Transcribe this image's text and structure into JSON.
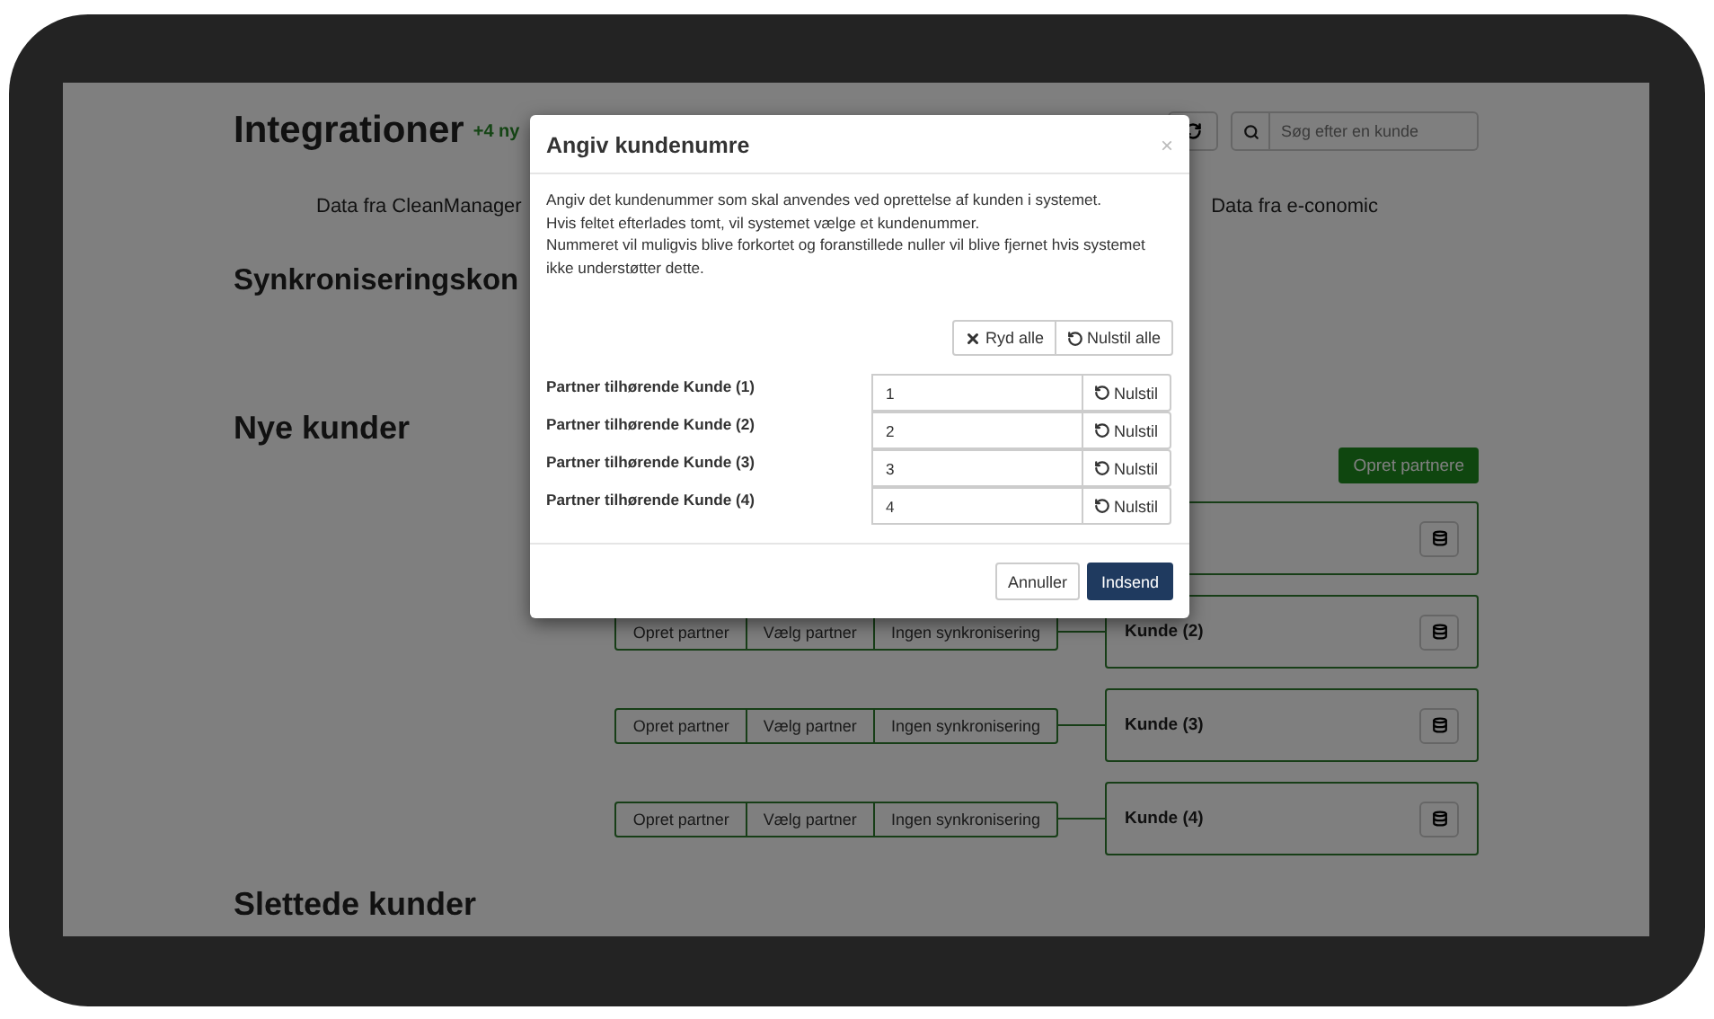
{
  "page": {
    "title": "Integrationer",
    "new_badge": "+4 ny",
    "refresh_button": true,
    "search": {
      "placeholder": "Søg efter en kunde"
    },
    "source_left": "Data fra CleanManager",
    "source_right": "Data fra e-conomic",
    "sync_heading": "Synkroniseringskon",
    "new_heading": "Nye kunder",
    "create_all_button": "Opret partnere",
    "customers": [
      {
        "kind": "card_only"
      },
      {
        "kind": "full",
        "actions": [
          "Opret partner",
          "Vælg partner",
          "Ingen synkronisering"
        ],
        "label": "Kunde (2)"
      },
      {
        "kind": "full",
        "actions": [
          "Opret partner",
          "Vælg partner",
          "Ingen synkronisering"
        ],
        "label": "Kunde (3)"
      },
      {
        "kind": "full",
        "actions": [
          "Opret partner",
          "Vælg partner",
          "Ingen synkronisering"
        ],
        "label": "Kunde (4)"
      }
    ],
    "deleted_heading": "Slettede kunder"
  },
  "modal": {
    "title": "Angiv kundenumre",
    "close": "×",
    "description": [
      "Angiv det kundenummer som skal anvendes ved oprettelse af kunden i systemet.",
      "Hvis feltet efterlades tomt, vil systemet vælge et kundenummer.",
      "Nummeret vil muligvis blive forkortet og foranstillede nuller vil blive fjernet hvis systemet ikke understøtter dette."
    ],
    "clear_all": "Ryd alle",
    "reset_all": "Nulstil alle",
    "fields": [
      {
        "label": "Partner tilhørende Kunde (1)",
        "value": "1",
        "reset": "Nulstil"
      },
      {
        "label": "Partner tilhørende Kunde (2)",
        "value": "2",
        "reset": "Nulstil"
      },
      {
        "label": "Partner tilhørende Kunde (3)",
        "value": "3",
        "reset": "Nulstil"
      },
      {
        "label": "Partner tilhørende Kunde (4)",
        "value": "4",
        "reset": "Nulstil"
      }
    ],
    "cancel": "Annuller",
    "submit": "Indsend"
  }
}
